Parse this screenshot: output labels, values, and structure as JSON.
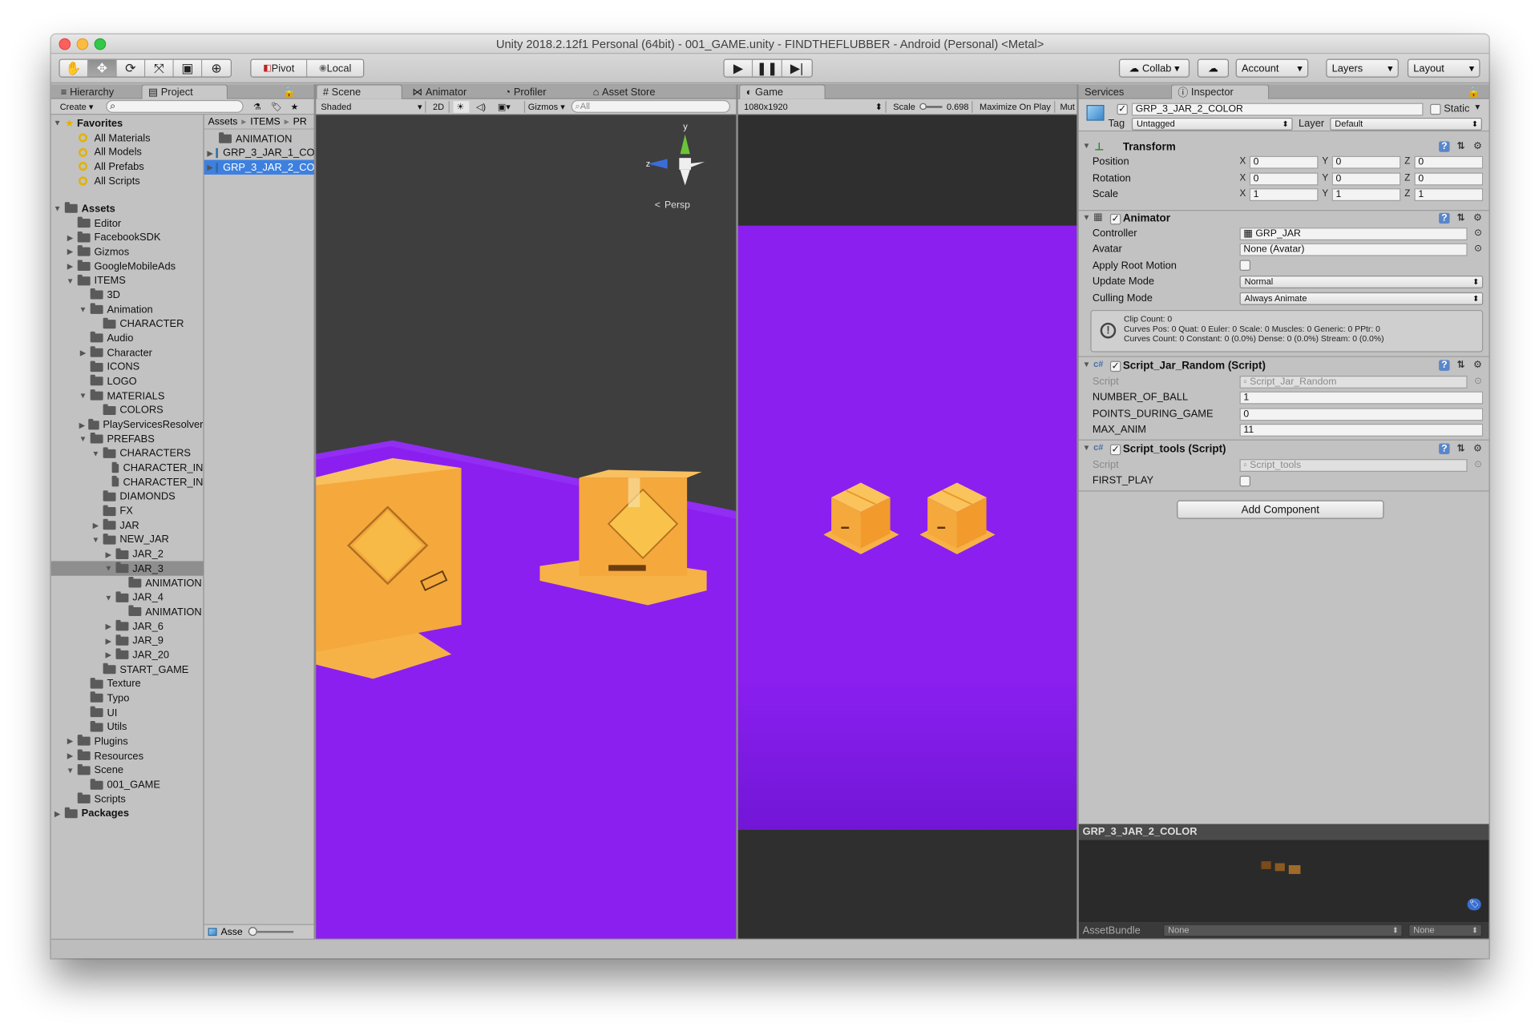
{
  "window": {
    "title": "Unity 2018.2.12f1 Personal (64bit) - 001_GAME.unity - FINDTHEFLUBBER - Android (Personal) <Metal>"
  },
  "toolbar": {
    "tool_icons": [
      "hand-icon",
      "move-icon",
      "rotate-icon",
      "scale-icon",
      "rect-icon",
      "transform-icon"
    ],
    "pivot_label": "Pivot",
    "local_label": "Local",
    "collab_label": "Collab",
    "account_label": "Account",
    "layers_label": "Layers",
    "layout_label": "Layout"
  },
  "tabs": {
    "hierarchy": "Hierarchy",
    "project": "Project",
    "scene": "Scene",
    "animator": "Animator",
    "profiler": "Profiler",
    "asset_store": "Asset Store",
    "game": "Game",
    "services": "Services",
    "inspector": "Inspector"
  },
  "project": {
    "create_label": "Create",
    "favorites_label": "Favorites",
    "favorites": [
      "All Materials",
      "All Models",
      "All Prefabs",
      "All Scripts"
    ],
    "assets_label": "Assets",
    "tree": [
      {
        "label": "Editor",
        "depth": 1,
        "arrow": ""
      },
      {
        "label": "FacebookSDK",
        "depth": 1,
        "arrow": "▶"
      },
      {
        "label": "Gizmos",
        "depth": 1,
        "arrow": "▶"
      },
      {
        "label": "GoogleMobileAds",
        "depth": 1,
        "arrow": "▶"
      },
      {
        "label": "ITEMS",
        "depth": 1,
        "arrow": "▼"
      },
      {
        "label": "3D",
        "depth": 2,
        "arrow": ""
      },
      {
        "label": "Animation",
        "depth": 2,
        "arrow": "▼"
      },
      {
        "label": "CHARACTER",
        "depth": 3,
        "arrow": ""
      },
      {
        "label": "Audio",
        "depth": 2,
        "arrow": ""
      },
      {
        "label": "Character",
        "depth": 2,
        "arrow": "▶"
      },
      {
        "label": "ICONS",
        "depth": 2,
        "arrow": ""
      },
      {
        "label": "LOGO",
        "depth": 2,
        "arrow": ""
      },
      {
        "label": "MATERIALS",
        "depth": 2,
        "arrow": "▼"
      },
      {
        "label": "COLORS",
        "depth": 3,
        "arrow": ""
      },
      {
        "label": "PlayServicesResolver",
        "depth": 2,
        "arrow": "▶"
      },
      {
        "label": "PREFABS",
        "depth": 2,
        "arrow": "▼"
      },
      {
        "label": "CHARACTERS",
        "depth": 3,
        "arrow": "▼"
      },
      {
        "label": "CHARACTER_IN",
        "depth": 4,
        "arrow": ""
      },
      {
        "label": "CHARACTER_IN",
        "depth": 4,
        "arrow": ""
      },
      {
        "label": "DIAMONDS",
        "depth": 3,
        "arrow": ""
      },
      {
        "label": "FX",
        "depth": 3,
        "arrow": ""
      },
      {
        "label": "JAR",
        "depth": 3,
        "arrow": "▶"
      },
      {
        "label": "NEW_JAR",
        "depth": 3,
        "arrow": "▼"
      },
      {
        "label": "JAR_2",
        "depth": 4,
        "arrow": "▶"
      },
      {
        "label": "JAR_3",
        "depth": 4,
        "arrow": "▼",
        "selected": true
      },
      {
        "label": "ANIMATION",
        "depth": 5,
        "arrow": ""
      },
      {
        "label": "JAR_4",
        "depth": 4,
        "arrow": "▼"
      },
      {
        "label": "ANIMATION",
        "depth": 5,
        "arrow": ""
      },
      {
        "label": "JAR_6",
        "depth": 4,
        "arrow": "▶"
      },
      {
        "label": "JAR_9",
        "depth": 4,
        "arrow": "▶"
      },
      {
        "label": "JAR_20",
        "depth": 4,
        "arrow": "▶"
      },
      {
        "label": "START_GAME",
        "depth": 3,
        "arrow": ""
      },
      {
        "label": "Texture",
        "depth": 2,
        "arrow": ""
      },
      {
        "label": "Typo",
        "depth": 2,
        "arrow": ""
      },
      {
        "label": "UI",
        "depth": 2,
        "arrow": ""
      },
      {
        "label": "Utils",
        "depth": 2,
        "arrow": ""
      },
      {
        "label": "Plugins",
        "depth": 1,
        "arrow": "▶"
      },
      {
        "label": "Resources",
        "depth": 1,
        "arrow": "▶"
      },
      {
        "label": "Scene",
        "depth": 1,
        "arrow": "▼"
      },
      {
        "label": "001_GAME",
        "depth": 2,
        "arrow": ""
      },
      {
        "label": "Scripts",
        "depth": 1,
        "arrow": ""
      },
      {
        "label": "Packages",
        "depth": 0,
        "arrow": "▶",
        "bold": true
      }
    ],
    "breadcrumb": [
      "Assets",
      "ITEMS",
      "PR"
    ],
    "files": [
      {
        "label": "ANIMATION",
        "type": "folder"
      },
      {
        "label": "GRP_3_JAR_1_CO",
        "type": "prefab"
      },
      {
        "label": "GRP_3_JAR_2_CO",
        "type": "prefab",
        "selected": true
      }
    ],
    "bottom_label": "Asse"
  },
  "scene": {
    "shading_mode": "Shaded",
    "mode_2d": "2D",
    "gizmos_label": "Gizmos",
    "search_placeholder": "All",
    "persp_label": "Persp",
    "axis_y": "y",
    "axis_z": "z"
  },
  "game": {
    "resolution": "1080x1920",
    "scale_label": "Scale",
    "scale_value": "0.698",
    "maximize_label": "Maximize On Play",
    "mute_label": "Mut"
  },
  "inspector": {
    "object_name": "GRP_3_JAR_2_COLOR",
    "static_label": "Static",
    "tag_label": "Tag",
    "tag_value": "Untagged",
    "layer_label": "Layer",
    "layer_value": "Default",
    "transform": {
      "title": "Transform",
      "rows": [
        {
          "label": "Position",
          "x": "0",
          "y": "0",
          "z": "0"
        },
        {
          "label": "Rotation",
          "x": "0",
          "y": "0",
          "z": "0"
        },
        {
          "label": "Scale",
          "x": "1",
          "y": "1",
          "z": "1"
        }
      ],
      "x_label": "X",
      "y_label": "Y",
      "z_label": "Z"
    },
    "animator": {
      "title": "Animator",
      "controller_label": "Controller",
      "controller_value": "GRP_JAR",
      "avatar_label": "Avatar",
      "avatar_value": "None (Avatar)",
      "apply_root_label": "Apply Root Motion",
      "update_mode_label": "Update Mode",
      "update_mode_value": "Normal",
      "culling_mode_label": "Culling Mode",
      "culling_mode_value": "Always Animate",
      "info_line1": "Clip Count: 0",
      "info_line2": "Curves Pos: 0 Quat: 0 Euler: 0 Scale: 0 Muscles: 0 Generic: 0 PPtr: 0",
      "info_line3": "Curves Count: 0 Constant: 0 (0.0%) Dense: 0 (0.0%) Stream: 0 (0.0%)"
    },
    "script_random": {
      "title": "Script_Jar_Random (Script)",
      "script_label": "Script",
      "script_value": "Script_Jar_Random",
      "fields": [
        {
          "label": "NUMBER_OF_BALL",
          "value": "1"
        },
        {
          "label": "POINTS_DURING_GAME",
          "value": "0"
        },
        {
          "label": "MAX_ANIM",
          "value": "11"
        }
      ]
    },
    "script_tools": {
      "title": "Script_tools (Script)",
      "script_label": "Script",
      "script_value": "Script_tools",
      "first_play_label": "FIRST_PLAY"
    },
    "add_component_label": "Add Component",
    "preview_title": "GRP_3_JAR_2_COLOR",
    "assetbundle_label": "AssetBundle",
    "assetbundle_value": "None",
    "assetbundle_variant": "None"
  },
  "colors": {
    "purple": "#8a1ff0",
    "box": "#f2a53a",
    "panel": "#c2c2c2"
  }
}
